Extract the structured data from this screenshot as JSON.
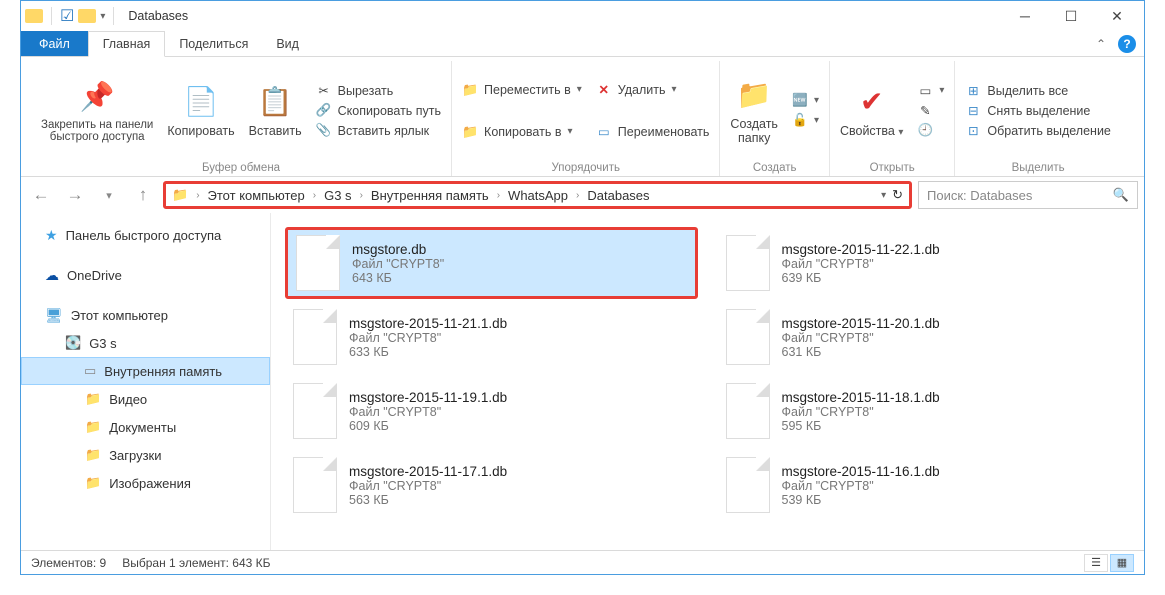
{
  "title": "Databases",
  "tabs": {
    "file": "Файл",
    "home": "Главная",
    "share": "Поделиться",
    "view": "Вид"
  },
  "ribbon": {
    "pin": "Закрепить на панели\nбыстрого доступа",
    "copy": "Копировать",
    "paste": "Вставить",
    "cut": "Вырезать",
    "copypath": "Скопировать путь",
    "pasteshortcut": "Вставить ярлык",
    "clipboard_label": "Буфер обмена",
    "moveto": "Переместить в",
    "copyto": "Копировать в",
    "delete": "Удалить",
    "rename": "Переименовать",
    "organize_label": "Упорядочить",
    "newfolder": "Создать\nпапку",
    "new_label": "Создать",
    "properties": "Свойства",
    "open_label": "Открыть",
    "selectall": "Выделить все",
    "selectnone": "Снять выделение",
    "invertsel": "Обратить выделение",
    "select_label": "Выделить"
  },
  "breadcrumb": [
    "Этот компьютер",
    "G3 s",
    "Внутренняя память",
    "WhatsApp",
    "Databases"
  ],
  "search_placeholder": "Поиск: Databases",
  "sidebar": {
    "quick": "Панель быстрого доступа",
    "onedrive": "OneDrive",
    "thispc": "Этот компьютер",
    "device": "G3 s",
    "internal": "Внутренняя память",
    "video": "Видео",
    "documents": "Документы",
    "downloads": "Загрузки",
    "images": "Изображения"
  },
  "files": [
    {
      "name": "msgstore.db",
      "type": "Файл \"CRYPT8\"",
      "size": "643 КБ",
      "selected": true
    },
    {
      "name": "msgstore-2015-11-22.1.db",
      "type": "Файл \"CRYPT8\"",
      "size": "639 КБ",
      "selected": false
    },
    {
      "name": "msgstore-2015-11-21.1.db",
      "type": "Файл \"CRYPT8\"",
      "size": "633 КБ",
      "selected": false
    },
    {
      "name": "msgstore-2015-11-20.1.db",
      "type": "Файл \"CRYPT8\"",
      "size": "631 КБ",
      "selected": false
    },
    {
      "name": "msgstore-2015-11-19.1.db",
      "type": "Файл \"CRYPT8\"",
      "size": "609 КБ",
      "selected": false
    },
    {
      "name": "msgstore-2015-11-18.1.db",
      "type": "Файл \"CRYPT8\"",
      "size": "595 КБ",
      "selected": false
    },
    {
      "name": "msgstore-2015-11-17.1.db",
      "type": "Файл \"CRYPT8\"",
      "size": "563 КБ",
      "selected": false
    },
    {
      "name": "msgstore-2015-11-16.1.db",
      "type": "Файл \"CRYPT8\"",
      "size": "539 КБ",
      "selected": false
    }
  ],
  "status": {
    "count": "Элементов: 9",
    "selected": "Выбран 1 элемент: 643 КБ"
  }
}
